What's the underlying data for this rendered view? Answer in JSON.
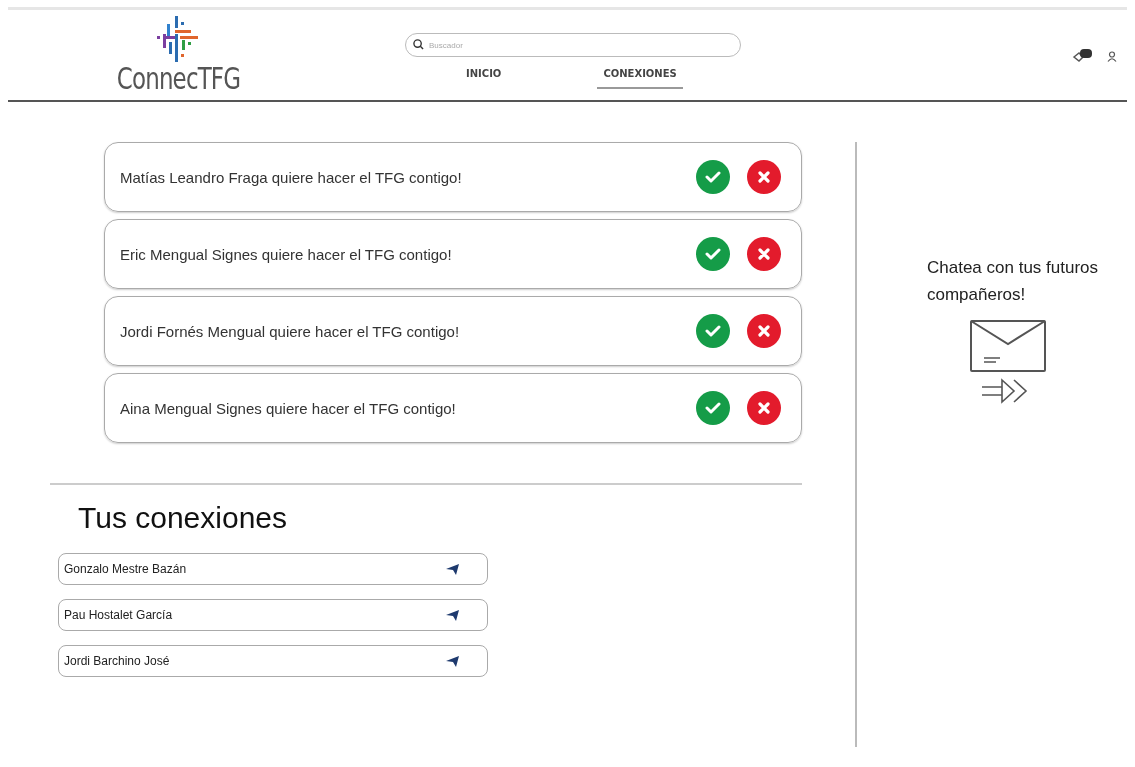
{
  "header": {
    "logo_text": "ConnecTFG",
    "search": {
      "placeholder": "Buscador"
    },
    "tabs": [
      {
        "label": "INICIO",
        "selected": false
      },
      {
        "label": "CONEXIONES",
        "selected": true
      }
    ]
  },
  "requests": [
    {
      "message": "Matías Leandro Fraga quiere hacer el TFG contigo!"
    },
    {
      "message": "Eric Mengual Signes quiere hacer el TFG contigo!"
    },
    {
      "message": "Jordi Fornés Mengual quiere hacer el TFG contigo!"
    },
    {
      "message": "Aina Mengual Signes quiere hacer el TFG contigo!"
    }
  ],
  "connections": {
    "title": "Tus conexiones",
    "items": [
      {
        "name": "Gonzalo Mestre Bazán"
      },
      {
        "name": "Pau Hostalet García"
      },
      {
        "name": "Jordi Barchino José"
      }
    ]
  },
  "chat_panel": {
    "text": "Chatea con tus futuros compañeros!"
  }
}
